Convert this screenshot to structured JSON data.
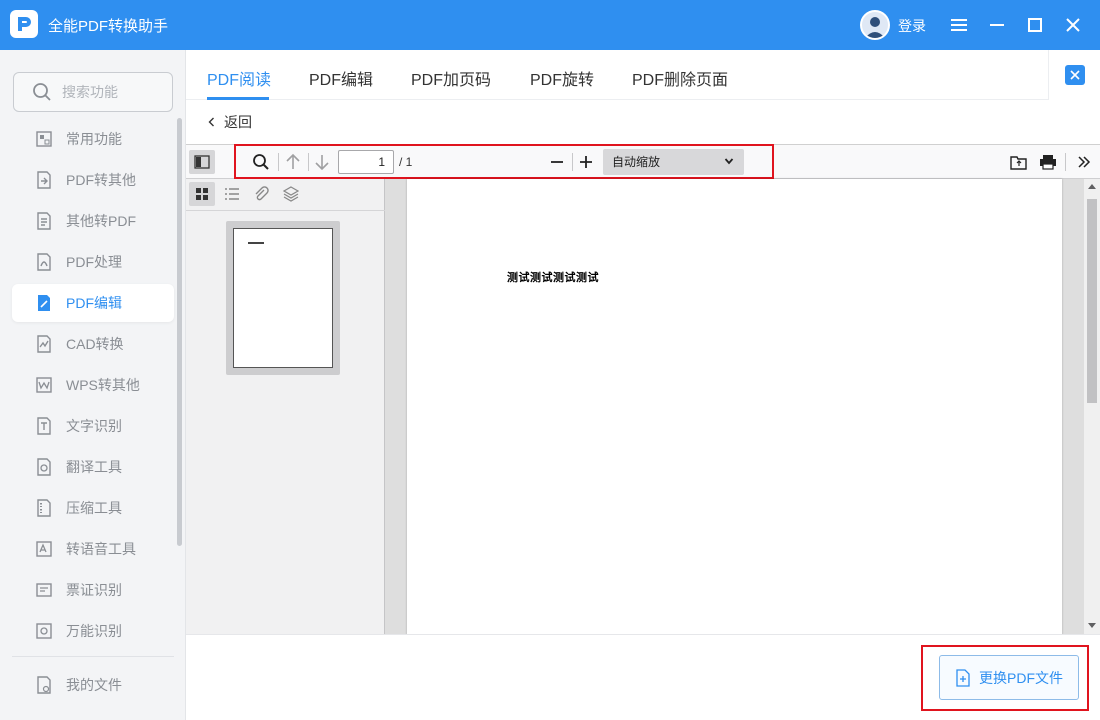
{
  "app": {
    "title": "全能PDF转换助手",
    "login": "登录"
  },
  "colors": {
    "accent": "#2f8ff0",
    "highlight": "#e0141e"
  },
  "sidebar": {
    "search_placeholder": "搜索功能",
    "items": [
      {
        "label": "常用功能",
        "icon": "home-grid-icon"
      },
      {
        "label": "PDF转其他",
        "icon": "pdf-export-icon"
      },
      {
        "label": "其他转PDF",
        "icon": "pdf-import-icon"
      },
      {
        "label": "PDF处理",
        "icon": "pdf-process-icon"
      },
      {
        "label": "PDF编辑",
        "icon": "pdf-edit-icon",
        "active": true
      },
      {
        "label": "CAD转换",
        "icon": "cad-icon"
      },
      {
        "label": "WPS转其他",
        "icon": "wps-icon"
      },
      {
        "label": "文字识别",
        "icon": "ocr-icon"
      },
      {
        "label": "翻译工具",
        "icon": "translate-icon"
      },
      {
        "label": "压缩工具",
        "icon": "zip-icon"
      },
      {
        "label": "转语音工具",
        "icon": "speech-icon"
      },
      {
        "label": "票证识别",
        "icon": "ticket-icon"
      },
      {
        "label": "万能识别",
        "icon": "eye-scan-icon"
      }
    ],
    "my_files": "我的文件"
  },
  "tabs": [
    "PDF阅读",
    "PDF编辑",
    "PDF加页码",
    "PDF旋转",
    "PDF删除页面"
  ],
  "active_tab": "PDF阅读",
  "back_label": "返回",
  "viewer": {
    "page_number": "1",
    "page_total": "/ 1",
    "zoom": "自动缩放",
    "document_text": "测试测试测试测试"
  },
  "footer": {
    "replace_label": "更换PDF文件"
  }
}
